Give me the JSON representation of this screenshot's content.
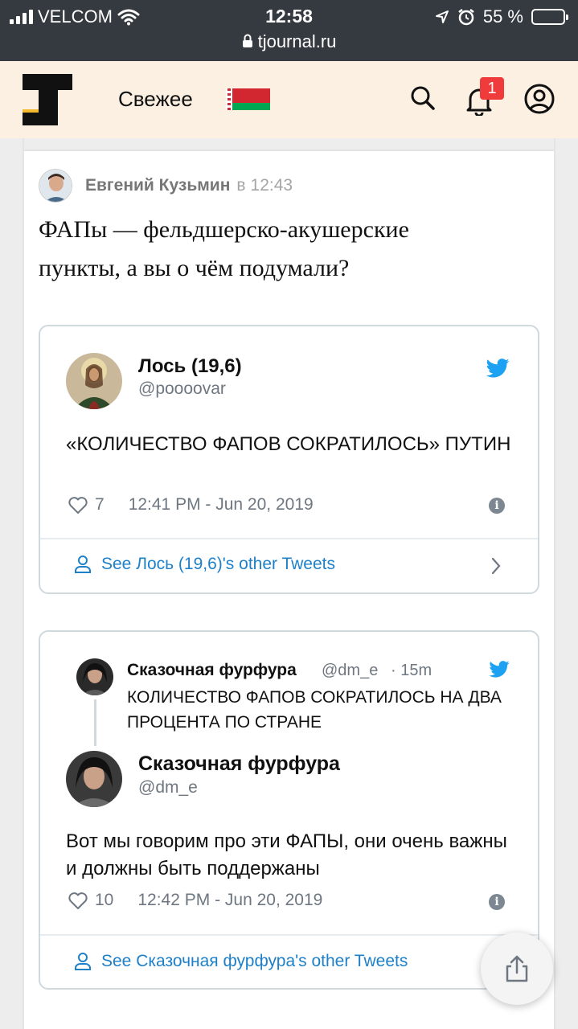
{
  "status_bar": {
    "carrier": "VELCOM",
    "time": "12:58",
    "url": "tjournal.ru",
    "battery": "55 %",
    "battery_level": 0.55
  },
  "header": {
    "logo": "tj-logo",
    "nav_fresh": "Свежее",
    "flag": "belarus-flag",
    "notifications_count": "1"
  },
  "comment": {
    "author": "Евгений Кузьмин",
    "time_prefix": "в",
    "time": "12:43",
    "text": "ФАПы — фельдшерско-акушерские пункты, а вы о чём подумали?"
  },
  "tweet1": {
    "name": "Лось (19,6)",
    "handle": "@poooovar",
    "text": "«КОЛИЧЕСТВО ФАПОВ СОКРАТИЛОСЬ» ПУТИН",
    "likes": "7",
    "datetime": "12:41 PM - Jun 20, 2019",
    "see_more": "See Лось (19,6)'s other Tweets"
  },
  "tweet2": {
    "parent": {
      "name": "Сказочная фурфура",
      "handle": "@dm_e",
      "age": "· 15m",
      "text": "КОЛИЧЕСТВО ФАПОВ СОКРАТИЛОСЬ НА ДВА ПРОЦЕНТА ПО СТРАНЕ"
    },
    "name": "Сказочная фурфура",
    "handle": "@dm_e",
    "text": "Вот мы говорим про эти ФАПЫ, они очень важны и должны быть поддержаны",
    "likes": "10",
    "datetime": "12:42 PM - Jun 20, 2019",
    "see_more": "See Сказочная фурфура's other Tweets"
  },
  "colors": {
    "status_bg": "#353a40",
    "header_bg": "#fbf0e2",
    "twitter_blue": "#1da1f2",
    "link_blue": "#1d80c9",
    "badge_red": "#ef3b3b"
  }
}
